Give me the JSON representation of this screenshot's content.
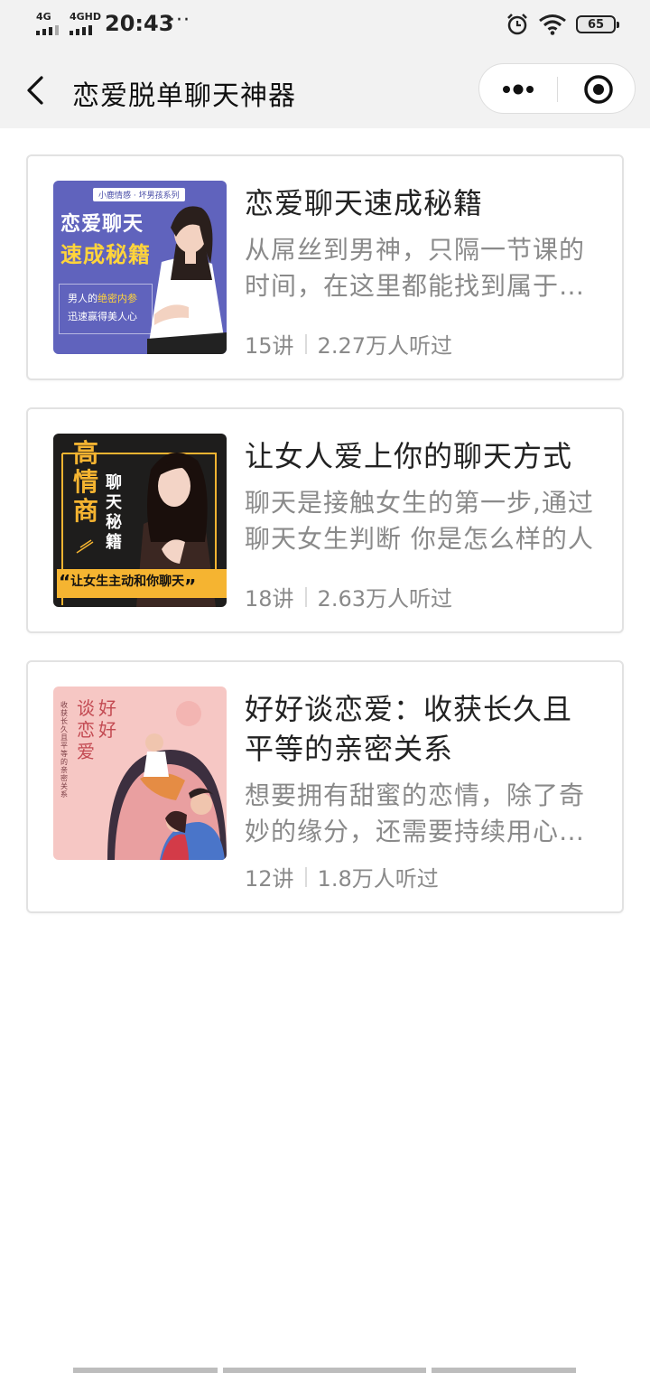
{
  "status_bar": {
    "network_1": "4G",
    "network_2": "4GHD",
    "time": "20:43",
    "more": "···",
    "battery": "65"
  },
  "nav": {
    "title": "恋爱脱单聊天神器"
  },
  "courses": [
    {
      "title": "恋爱聊天速成秘籍",
      "description": "从屌丝到男神，只隔一节课的时间，在这里都能找到属于你的",
      "lessons": "15讲",
      "listeners": "2.27万人听过",
      "thumb": {
        "tag": "小鹿情感 · 坏男孩系列",
        "line1": "恋爱聊天",
        "line2": "速成秘籍",
        "quote1_pre": "男人的",
        "quote1_hl": "绝密内参",
        "quote2": "迅速赢得美人心"
      }
    },
    {
      "title": "让女人爱上你的聊天方式",
      "description": "聊天是接触女生的第一步,通过聊天女生判断 你是怎么样的人",
      "lessons": "18讲",
      "listeners": "2.63万人听过",
      "thumb": {
        "big": "高情商",
        "side": "聊天秘籍",
        "banner": "让女生主动和你聊天"
      }
    },
    {
      "title": "好好谈恋爱：收获长久且平等的亲密关系",
      "description": "想要拥有甜蜜的恋情，除了奇妙的缘分，还需要持续用心的经营",
      "lessons": "12讲",
      "listeners": "1.8万人听过",
      "thumb": {
        "col1": "好好",
        "col2": "谈恋爱",
        "sub": "收获长久且平等的亲密关系"
      }
    }
  ],
  "colors": {
    "header_bg": "#f2f2f2",
    "thumb1_bg": "#5b5fb8",
    "thumb1_accent": "#ffd43b",
    "thumb2_bg": "#1e1d1c",
    "thumb2_accent": "#f5b431",
    "thumb3_bg": "#f6c7c4"
  }
}
